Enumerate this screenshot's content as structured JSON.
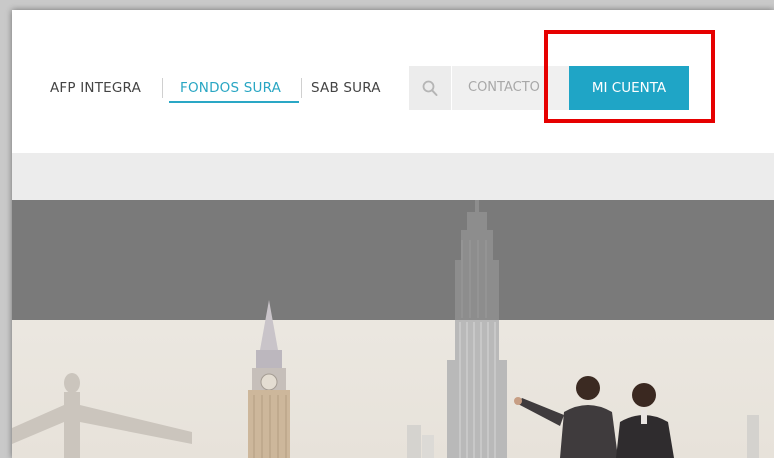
{
  "nav": {
    "items": [
      {
        "label": "AFP INTEGRA",
        "active": false
      },
      {
        "label": "FONDOS SURA",
        "active": true
      },
      {
        "label": "SAB SURA",
        "active": false
      }
    ],
    "search_icon": "search-icon",
    "contact_label": "CONTACTO",
    "account_label": "MI CUENTA"
  },
  "colors": {
    "accent": "#1fa5c6",
    "active_link": "#29a6c3",
    "highlight": "#e60000"
  }
}
